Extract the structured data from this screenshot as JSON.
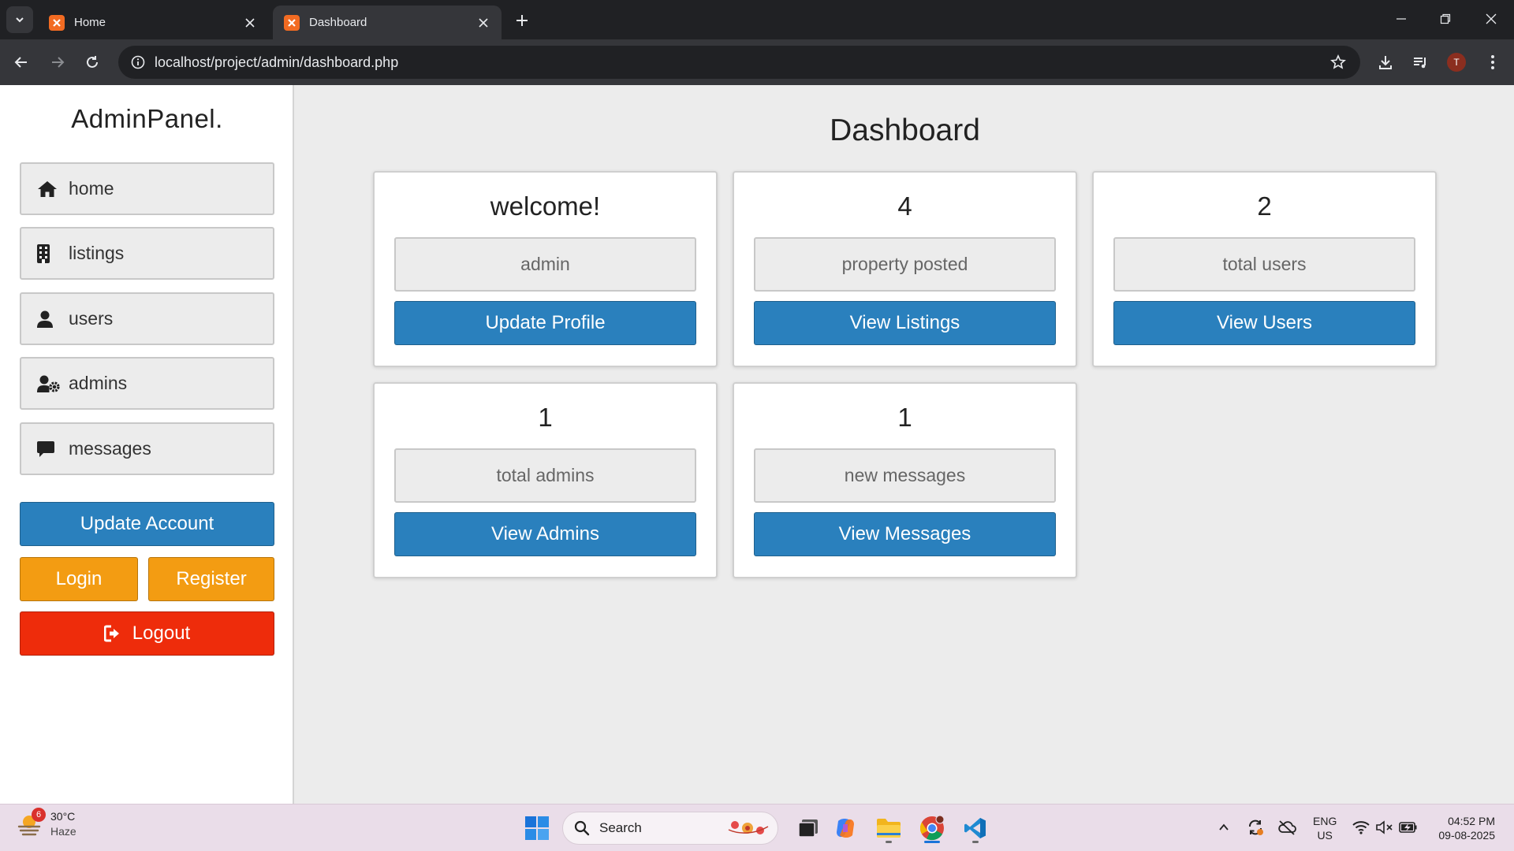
{
  "browser": {
    "tabs": [
      {
        "title": "Home",
        "active": false
      },
      {
        "title": "Dashboard",
        "active": true
      }
    ],
    "url": "localhost/project/admin/dashboard.php",
    "profile_initial": "T"
  },
  "sidebar": {
    "brand": "AdminPanel.",
    "nav": [
      {
        "label": "home",
        "icon": "home-icon"
      },
      {
        "label": "listings",
        "icon": "building-icon"
      },
      {
        "label": "users",
        "icon": "user-icon"
      },
      {
        "label": "admins",
        "icon": "user-gear-icon"
      },
      {
        "label": "messages",
        "icon": "message-icon"
      }
    ],
    "update_account": "Update Account",
    "login": "Login",
    "register": "Register",
    "logout": "Logout"
  },
  "main": {
    "title": "Dashboard",
    "cards": [
      {
        "value": "welcome!",
        "label": "admin",
        "button": "Update Profile"
      },
      {
        "value": "4",
        "label": "property posted",
        "button": "View Listings"
      },
      {
        "value": "2",
        "label": "total users",
        "button": "View Users"
      },
      {
        "value": "1",
        "label": "total admins",
        "button": "View Admins"
      },
      {
        "value": "1",
        "label": "new messages",
        "button": "View Messages"
      }
    ]
  },
  "taskbar": {
    "weather": {
      "temp": "30°C",
      "condition": "Haze",
      "badge": "6"
    },
    "search_placeholder": "Search",
    "lang": {
      "line1": "ENG",
      "line2": "US"
    },
    "clock": {
      "time": "04:52 PM",
      "date": "09-08-2025"
    }
  },
  "colors": {
    "primary_blue": "#2a80bd",
    "orange": "#f39c12",
    "red": "#ee2c0b",
    "chrome_dark": "#202124"
  }
}
